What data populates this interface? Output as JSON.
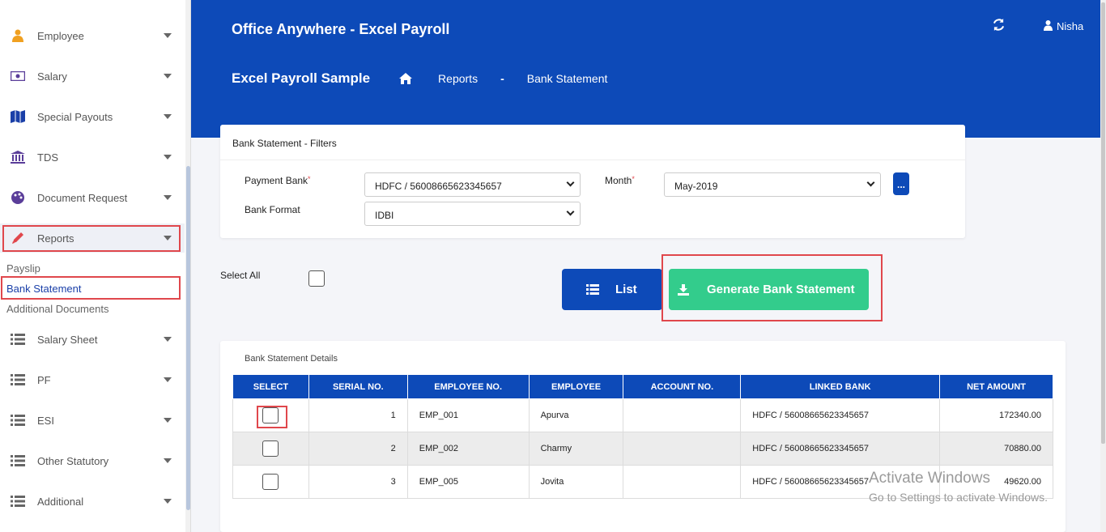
{
  "sidebar": {
    "items": [
      {
        "label": "Employee",
        "icon": "user-icon",
        "color": "#f0a020"
      },
      {
        "label": "Salary",
        "icon": "money-icon",
        "color": "#5a3d99"
      },
      {
        "label": "Special Payouts",
        "icon": "map-icon",
        "color": "#1a3fa8"
      },
      {
        "label": "TDS",
        "icon": "bank-icon",
        "color": "#5a3d99"
      },
      {
        "label": "Document Request",
        "icon": "palette-icon",
        "color": "#5a3d99"
      },
      {
        "label": "Reports",
        "icon": "pencil-icon",
        "color": "#e0474c"
      }
    ],
    "sub_items": [
      "Payslip",
      "Bank Statement",
      "Additional Documents"
    ],
    "items_after": [
      {
        "label": "Salary Sheet",
        "icon": "list-icon"
      },
      {
        "label": "PF",
        "icon": "list-icon"
      },
      {
        "label": "ESI",
        "icon": "list-icon"
      },
      {
        "label": "Other Statutory",
        "icon": "list-icon"
      },
      {
        "label": "Additional",
        "icon": "list-icon"
      }
    ]
  },
  "header": {
    "app_title": "Office Anywhere - Excel Payroll",
    "user_name": "Nisha",
    "page_title": "Excel Payroll Sample",
    "breadcrumb": [
      "Reports",
      "-",
      "Bank Statement"
    ]
  },
  "filters": {
    "title": "Bank Statement - Filters",
    "payment_bank_label": "Payment Bank",
    "payment_bank_value": "HDFC / 56008665623345657",
    "bank_format_label": "Bank Format",
    "bank_format_value": "IDBI",
    "month_label": "Month",
    "month_value": "May-2019",
    "required_mark": "*",
    "more_label": "..."
  },
  "actions": {
    "select_all_label": "Select All",
    "list_label": "List",
    "generate_label": "Generate Bank Statement"
  },
  "details": {
    "title": "Bank Statement Details",
    "columns": [
      "SELECT",
      "SERIAL NO.",
      "EMPLOYEE NO.",
      "EMPLOYEE",
      "ACCOUNT NO.",
      "LINKED BANK",
      "NET AMOUNT"
    ],
    "rows": [
      {
        "serial": "1",
        "emp_no": "EMP_001",
        "employee": "Apurva",
        "account": "",
        "bank": "HDFC / 56008665623345657",
        "amount": "172340.00"
      },
      {
        "serial": "2",
        "emp_no": "EMP_002",
        "employee": "Charmy",
        "account": "",
        "bank": "HDFC / 56008665623345657",
        "amount": "70880.00"
      },
      {
        "serial": "3",
        "emp_no": "EMP_005",
        "employee": "Jovita",
        "account": "",
        "bank": "HDFC / 56008665623345657",
        "amount": "49620.00"
      }
    ]
  },
  "watermark": {
    "line1": "Activate Windows",
    "line2": "Go to Settings to activate Windows."
  },
  "colors": {
    "primary": "#0d4ab8",
    "success": "#33cc8c",
    "highlight": "#e0474c"
  }
}
